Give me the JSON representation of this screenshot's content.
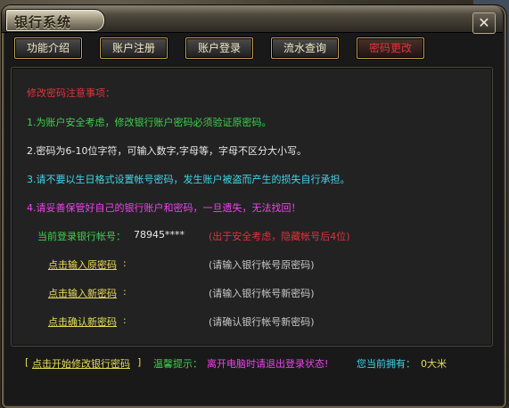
{
  "window": {
    "title": "银行系统",
    "close_symbol": "✕"
  },
  "tabs": [
    {
      "label": "功能介绍",
      "active": false
    },
    {
      "label": "账户注册",
      "active": false
    },
    {
      "label": "账户登录",
      "active": false
    },
    {
      "label": "流水查询",
      "active": false
    },
    {
      "label": "密码更改",
      "active": true
    }
  ],
  "notice": {
    "heading": "修改密码注意事项：",
    "items": [
      "1.为账户安全考虑，修改银行账户密码必须验证原密码。",
      "2.密码为6-10位字符，可输入数字,字母等，字母不区分大小写。",
      "3.请不要以生日格式设置帐号密码，发生账户被盗而产生的损失自行承担。",
      "4.请妥善保管好自己的银行账户和密码，一旦遗失，无法找回！"
    ]
  },
  "account": {
    "label": "当前登录银行帐号：",
    "value": "78945****",
    "security_note": "(出于安全考虑，隐藏帐号后4位)"
  },
  "fields": [
    {
      "link": "点击输入原密码",
      "suffix": ":",
      "hint": "(请输入银行帐号原密码)"
    },
    {
      "link": "点击输入新密码",
      "suffix": ":",
      "hint": "(请输入银行帐号新密码)"
    },
    {
      "link": "点击确认新密码",
      "suffix": ":",
      "hint": "(请确认银行帐号新密码)"
    }
  ],
  "footer": {
    "bracket_left": "[",
    "action": "点击开始修改银行密码",
    "bracket_right": "]",
    "tip_label": "温馨提示：",
    "tip_text": "离开电脑时请退出登录状态!",
    "balance_label": "您当前拥有：",
    "balance_value": "0大米"
  },
  "colors": {
    "heading": "#e3323a",
    "green": "#3ed24a",
    "yellow": "#e7dc59",
    "cyan": "#3fd7e8",
    "pink": "#ee44ee"
  }
}
